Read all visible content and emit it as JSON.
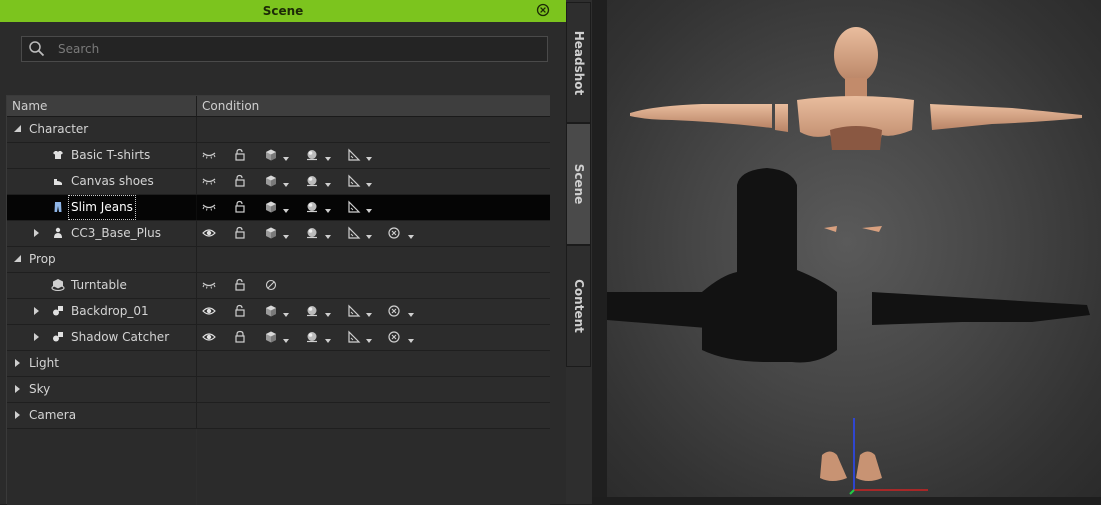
{
  "title": "Scene",
  "search": {
    "placeholder": "Search"
  },
  "columns": {
    "name": "Name",
    "condition": "Condition"
  },
  "rows": [
    {
      "label": "Character"
    },
    {
      "label": "Basic T-shirts"
    },
    {
      "label": "Canvas shoes"
    },
    {
      "label": "Slim Jeans"
    },
    {
      "label": "CC3_Base_Plus"
    },
    {
      "label": "Prop"
    },
    {
      "label": "Turntable"
    },
    {
      "label": "Backdrop_01"
    },
    {
      "label": "Shadow Catcher"
    },
    {
      "label": "Light"
    },
    {
      "label": "Sky"
    },
    {
      "label": "Camera"
    }
  ],
  "side_tabs": {
    "headshot": "Headshot",
    "scene": "Scene",
    "content": "Content"
  },
  "colors": {
    "title_bar": "#7cc41e",
    "selected_row": "#050505",
    "panel": "#2b2b2b"
  }
}
